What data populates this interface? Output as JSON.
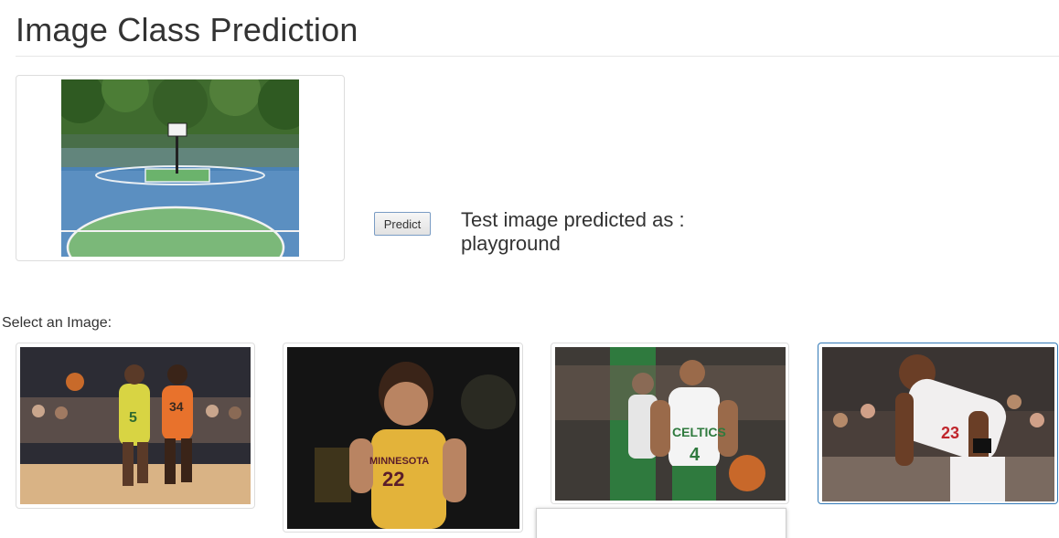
{
  "header": {
    "title": "Image Class Prediction"
  },
  "preview": {
    "image_description_icon": "basketball-court-image"
  },
  "predict_button": {
    "label": "Predict"
  },
  "result": {
    "line1": "Test image predicted as :",
    "line2": "playground"
  },
  "gallery": {
    "label": "Select an Image:",
    "images": [
      {
        "icon": "basketball-players-image",
        "jersey_left": "5",
        "jersey_right": "34"
      },
      {
        "icon": "minnesota-player-image",
        "team": "MINNESOTA",
        "number": "22"
      },
      {
        "icon": "celtics-player-image",
        "team": "CELTICS",
        "number": "4"
      },
      {
        "icon": "bulls-player-image",
        "number": "23"
      }
    ],
    "selected_index": 3
  },
  "colors": {
    "selection_border": "#337ab7",
    "text": "#333333",
    "button_border": "#7a9cc4"
  }
}
